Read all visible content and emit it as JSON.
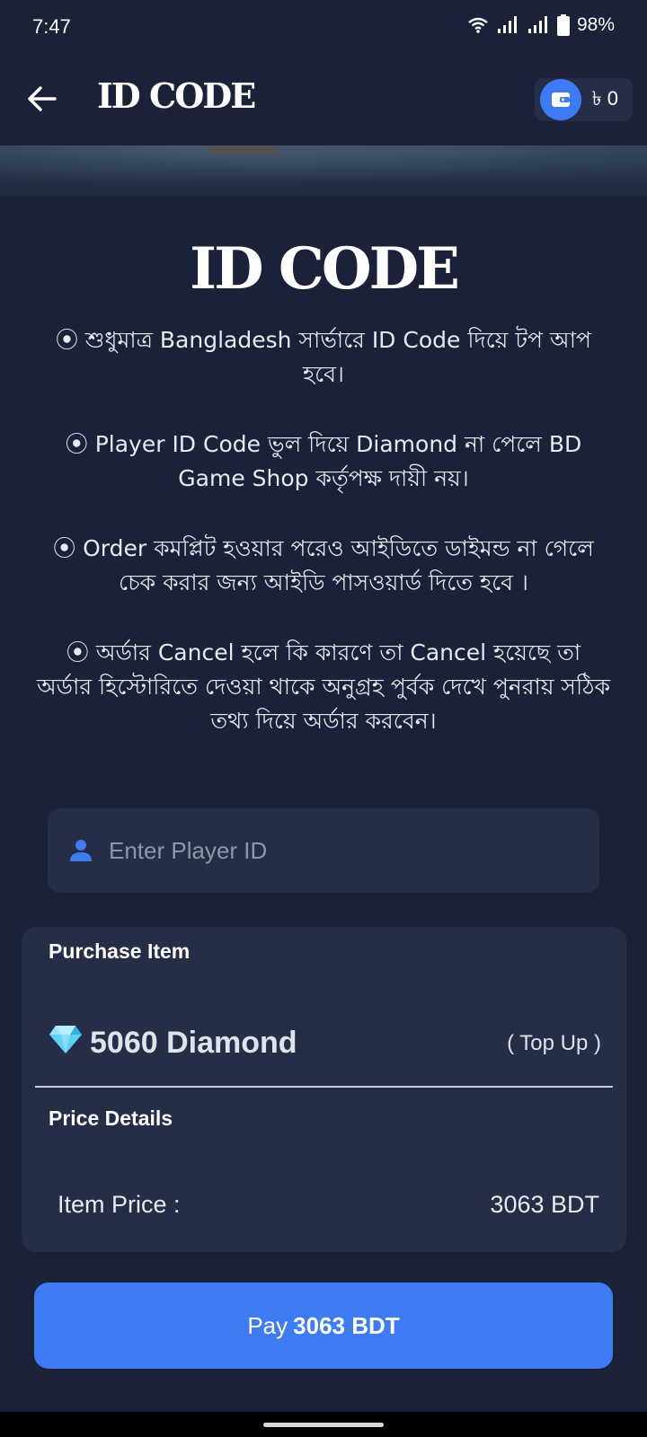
{
  "status_bar": {
    "time": "7:47",
    "battery": "98%",
    "icons": [
      "wifi-icon",
      "signal-icon",
      "signal-icon",
      "battery-icon"
    ]
  },
  "app_bar": {
    "title": "ID CODE",
    "wallet_balance": "৳ 0",
    "icons": [
      "back-arrow-icon",
      "wallet-icon"
    ]
  },
  "game": {
    "logo_text": "ID CODE"
  },
  "notes": [
    "⦿ শুধুমাত্র Bangladesh সার্ভারে ID Code দিয়ে টপ আপ হবে।",
    "⦿ Player ID Code ভুল দিয়ে Diamond না পেলে BD Game Shop কর্তৃপক্ষ দায়ী নয়।",
    "⦿ Order কমপ্লিট হওয়ার পরেও আইডিতে ডাইমন্ড না গেলে চেক করার জন্য আইডি পাসওয়ার্ড দিতে হবে ।",
    "⦿ অর্ডার Cancel হলে কি কারণে তা Cancel হয়েছে তা অর্ডার হিস্টোরিতে দেওয়া থাকে অনুগ্রহ পুর্বক দেখে পুনরায় সঠিক তথ্য দিয়ে অর্ডার করবেন।"
  ],
  "player_input": {
    "placeholder": "Enter Player ID",
    "value": "",
    "icon": "person-icon"
  },
  "purchase": {
    "heading": "Purchase Item",
    "item_name": "5060 Diamond",
    "item_icon": "diamond-icon",
    "item_tag": "( Top Up )",
    "price_heading": "Price Details",
    "price_label": "Item Price :",
    "price_value": "3063 BDT"
  },
  "pay_button": {
    "prefix": "Pay",
    "amount": "3063 BDT"
  },
  "colors": {
    "background": "#1b2138",
    "card": "#262d47",
    "accent": "#3d7cf5"
  }
}
